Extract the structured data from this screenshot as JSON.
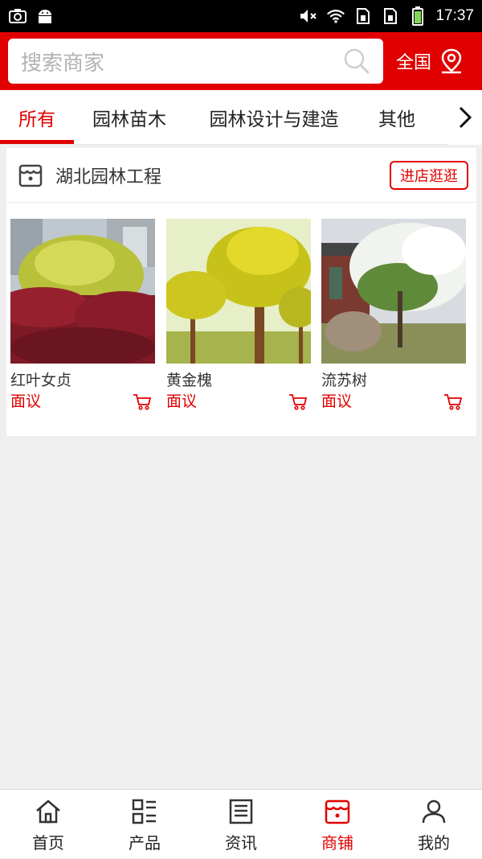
{
  "status_bar": {
    "time": "17:37",
    "icons": [
      "screenshot-icon",
      "android-icon",
      "mute-icon",
      "wifi-icon",
      "sim1-icon",
      "sim2-icon",
      "battery-icon"
    ]
  },
  "header": {
    "search_placeholder": "搜索商家",
    "region_label": "全国",
    "accent_color": "#e10000"
  },
  "tabs": {
    "items": [
      {
        "label": "所有",
        "active": true
      },
      {
        "label": "园林苗木",
        "active": false
      },
      {
        "label": "园林设计与建造",
        "active": false
      },
      {
        "label": "其他",
        "active": false
      }
    ]
  },
  "shop": {
    "name": "湖北园林工程",
    "enter_label": "进店逛逛",
    "products": [
      {
        "name": "红叶女贞",
        "price": "面议"
      },
      {
        "name": "黄金槐",
        "price": "面议"
      },
      {
        "name": "流苏树",
        "price": "面议"
      }
    ]
  },
  "bottom_nav": {
    "items": [
      {
        "label": "首页",
        "icon": "home-icon",
        "active": false
      },
      {
        "label": "产品",
        "icon": "grid-list-icon",
        "active": false
      },
      {
        "label": "资讯",
        "icon": "news-icon",
        "active": false
      },
      {
        "label": "商铺",
        "icon": "shop-icon",
        "active": true
      },
      {
        "label": "我的",
        "icon": "user-icon",
        "active": false
      }
    ]
  }
}
